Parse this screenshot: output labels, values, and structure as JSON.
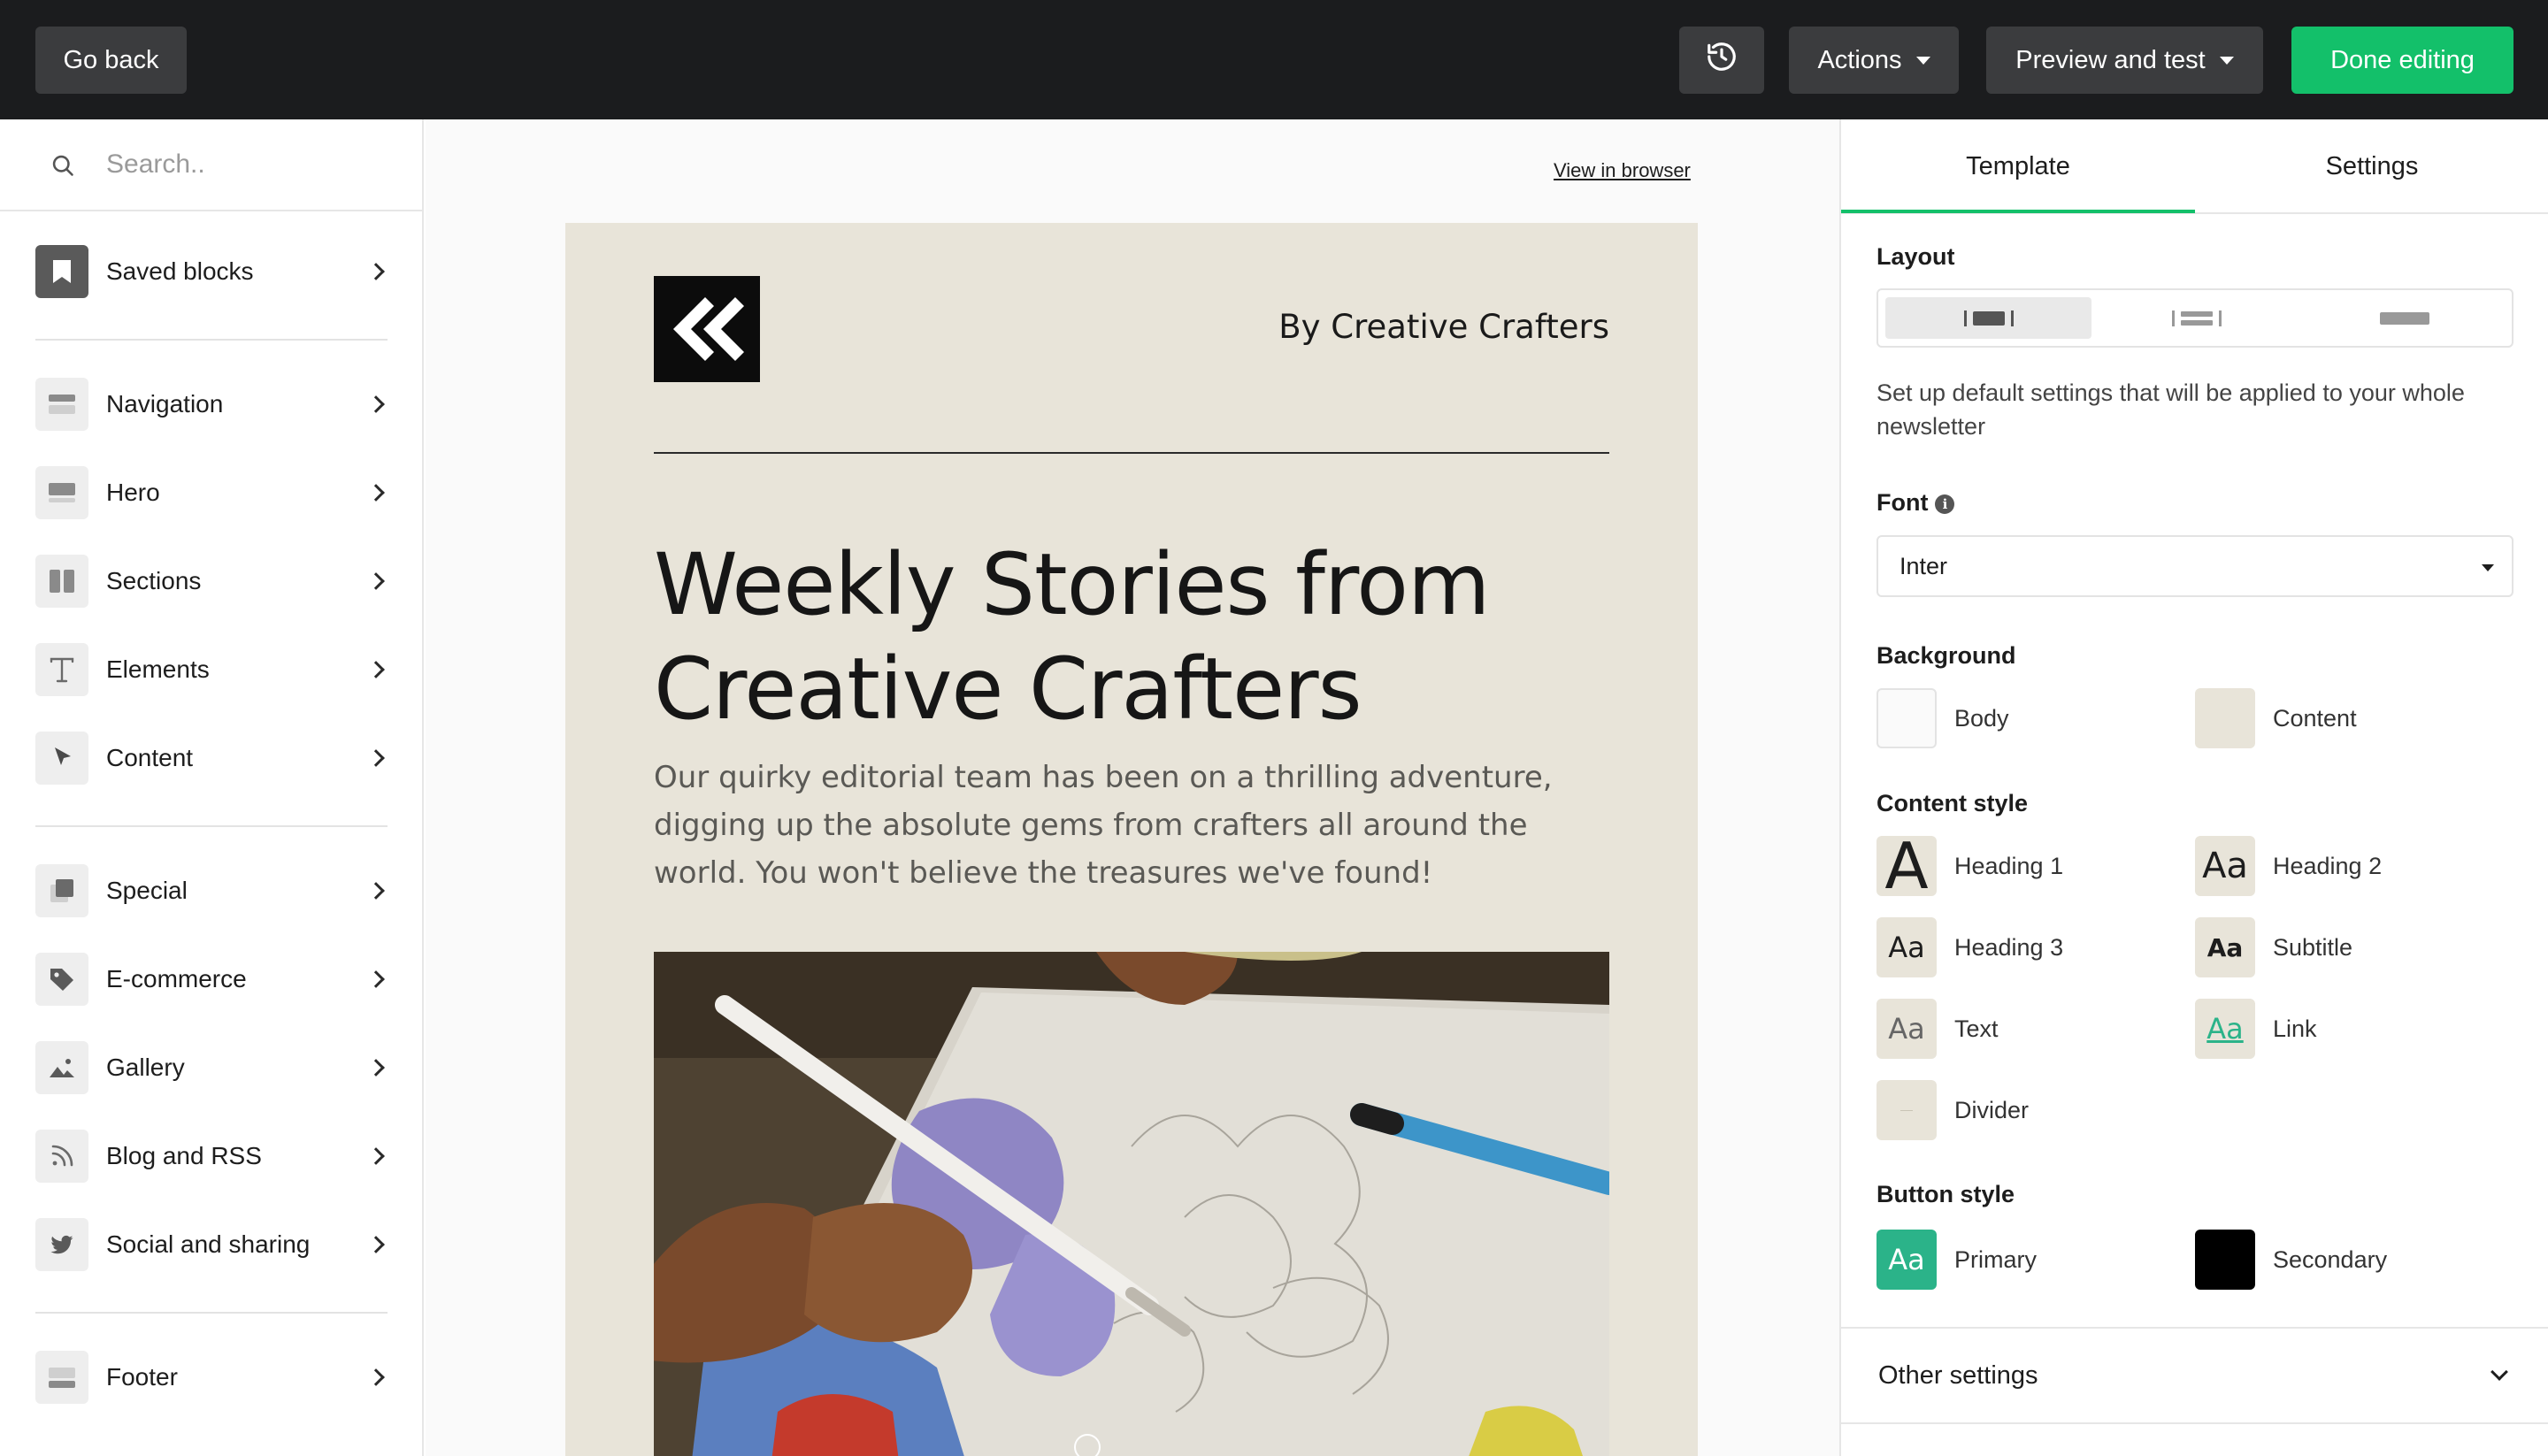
{
  "topbar": {
    "back_label": "Go back",
    "actions_label": "Actions",
    "preview_label": "Preview and test",
    "done_label": "Done editing",
    "done_color": "#13c06a"
  },
  "sidebar": {
    "search_placeholder": "Search..",
    "items": [
      {
        "label": "Saved blocks",
        "icon": "bookmark-icon"
      },
      {
        "label": "Navigation",
        "icon": "navigation-block-icon"
      },
      {
        "label": "Hero",
        "icon": "hero-block-icon"
      },
      {
        "label": "Sections",
        "icon": "sections-block-icon"
      },
      {
        "label": "Elements",
        "icon": "text-t-icon"
      },
      {
        "label": "Content",
        "icon": "cursor-icon"
      },
      {
        "label": "Special",
        "icon": "special-block-icon"
      },
      {
        "label": "E-commerce",
        "icon": "tag-icon"
      },
      {
        "label": "Gallery",
        "icon": "image-icon"
      },
      {
        "label": "Blog and RSS",
        "icon": "rss-icon"
      },
      {
        "label": "Social and sharing",
        "icon": "twitter-icon"
      },
      {
        "label": "Footer",
        "icon": "footer-block-icon"
      }
    ]
  },
  "canvas": {
    "view_in_browser": "View in browser",
    "email": {
      "byline": "By Creative Crafters",
      "headline_line1": "Weekly Stories from",
      "headline_line2": "Creative Crafters",
      "intro": "Our quirky editorial team has been on a thrilling adventure, digging up the absolute gems from crafters all around the world. You won't believe the treasures we've found!",
      "background": "#e8e4d9"
    }
  },
  "panel": {
    "tabs": [
      "Template",
      "Settings"
    ],
    "active_tab": "Template",
    "layout_title": "Layout",
    "description": "Set up default settings that will be applied to your whole newsletter",
    "font_title": "Font",
    "font_value": "Inter",
    "background_title": "Background",
    "background_items": [
      {
        "label": "Body",
        "color": "#fafafa"
      },
      {
        "label": "Content",
        "color": "#e8e4d9"
      }
    ],
    "content_style_title": "Content style",
    "content_styles": [
      {
        "label": "Heading 1",
        "glyph": "A"
      },
      {
        "label": "Heading 2",
        "glyph": "Aa"
      },
      {
        "label": "Heading 3",
        "glyph": "Aa"
      },
      {
        "label": "Subtitle",
        "glyph": "Aa"
      },
      {
        "label": "Text",
        "glyph": "Aa"
      },
      {
        "label": "Link",
        "glyph": "Aa"
      },
      {
        "label": "Divider",
        "glyph": ""
      }
    ],
    "button_style_title": "Button style",
    "button_styles": [
      {
        "label": "Primary",
        "glyph": "Aa",
        "color": "#2bb389"
      },
      {
        "label": "Secondary",
        "glyph": "",
        "color": "#000000"
      }
    ],
    "other_settings": "Other settings"
  }
}
